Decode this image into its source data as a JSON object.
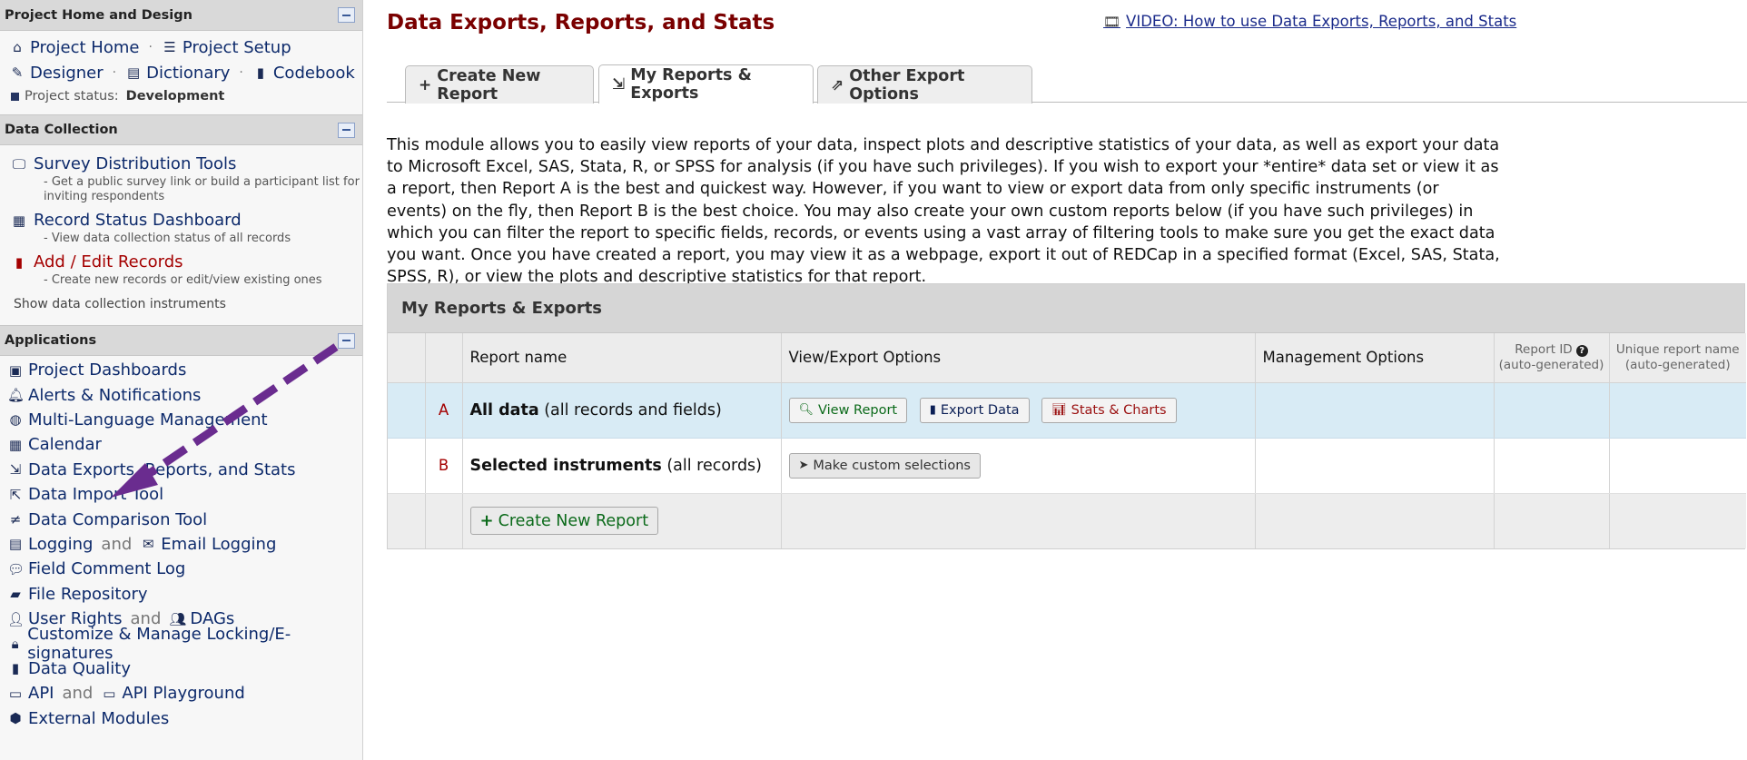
{
  "sidebar": {
    "project_home": {
      "header": "Project Home and Design",
      "links_row1": [
        {
          "label": "Project Home",
          "icon": "home-icon"
        },
        {
          "label": "Project Setup",
          "icon": "list-check-icon"
        }
      ],
      "links_row2": [
        {
          "label": "Designer",
          "icon": "edit-icon"
        },
        {
          "label": "Dictionary",
          "icon": "excel-icon"
        },
        {
          "label": "Codebook",
          "icon": "book-icon"
        }
      ],
      "status_label": "Project status:",
      "status_value": "Development"
    },
    "data_collection": {
      "header": "Data Collection",
      "items": [
        {
          "label": "Survey Distribution Tools",
          "desc": "- Get a public survey link or build a participant list for inviting respondents",
          "icon": "survey-icon",
          "color": "#0d2a6b"
        },
        {
          "label": "Record Status Dashboard",
          "desc": "- View data collection status of all records",
          "icon": "grid-icon",
          "color": "#0d2a6b"
        },
        {
          "label": "Add / Edit Records",
          "desc": "- Create new records or edit/view existing ones",
          "icon": "file-icon",
          "color": "#a40000"
        }
      ],
      "show_instruments": "Show data collection instruments"
    },
    "applications": {
      "header": "Applications",
      "items": [
        {
          "label": "Project Dashboards"
        },
        {
          "label": "Alerts & Notifications"
        },
        {
          "label": "Multi-Language Management"
        },
        {
          "label": "Calendar"
        },
        {
          "label": "Data Exports, Reports, and Stats"
        },
        {
          "label": "Data Import Tool"
        },
        {
          "label": "Data Comparison Tool"
        },
        {
          "label": "Logging",
          "and": "and",
          "label2": "Email Logging"
        },
        {
          "label": "Field Comment Log"
        },
        {
          "label": "File Repository"
        },
        {
          "label": "User Rights",
          "and": "and",
          "label2": "DAGs"
        },
        {
          "label": "Customize & Manage Locking/E-signatures"
        },
        {
          "label": "Data Quality"
        },
        {
          "label": "API",
          "and": "and",
          "label2": "API Playground"
        },
        {
          "label": "External Modules"
        }
      ]
    }
  },
  "main": {
    "title": "Data Exports, Reports, and Stats",
    "video_link": "VIDEO: How to use Data Exports, Reports, and Stats",
    "tabs": [
      {
        "label": "Create New Report"
      },
      {
        "label": "My Reports & Exports"
      },
      {
        "label": "Other Export Options"
      }
    ],
    "intro": "This module allows you to easily view reports of your data, inspect plots and descriptive statistics of your data, as well as export your data to Microsoft Excel, SAS, Stata, R, or SPSS for analysis (if you have such privileges). If you wish to export your *entire* data set or view it as a report, then Report A is the best and quickest way. However, if you want to view or export data from only specific instruments (or events) on the fly, then Report B is the best choice. You may also create your own custom reports below (if you have such privileges) in which you can filter the report to specific fields, records, or events using a vast array of filtering tools to make sure you get the exact data you want. Once you have created a report, you may view it as a webpage, export it out of REDCap in a specified format (Excel, SAS, Stata, SPSS, R), or view the plots and descriptive statistics for that report.",
    "reports": {
      "header": "My Reports & Exports",
      "columns": {
        "name": "Report name",
        "view_export": "View/Export Options",
        "management": "Management Options",
        "report_id_1": "Report ID",
        "report_id_2": "(auto-generated)",
        "unique_1": "Unique report name",
        "unique_2": "(auto-generated)"
      },
      "rows": [
        {
          "letter": "A",
          "name_bold": "All data",
          "name_rest": " (all records and fields)"
        },
        {
          "letter": "B",
          "name_bold": "Selected instruments",
          "name_rest": " (all records)"
        }
      ],
      "buttons": {
        "view_report": "View Report",
        "export_data": "Export Data",
        "stats_charts": "Stats & Charts",
        "custom_selections": "Make custom selections",
        "create_new": "Create New Report"
      }
    }
  }
}
